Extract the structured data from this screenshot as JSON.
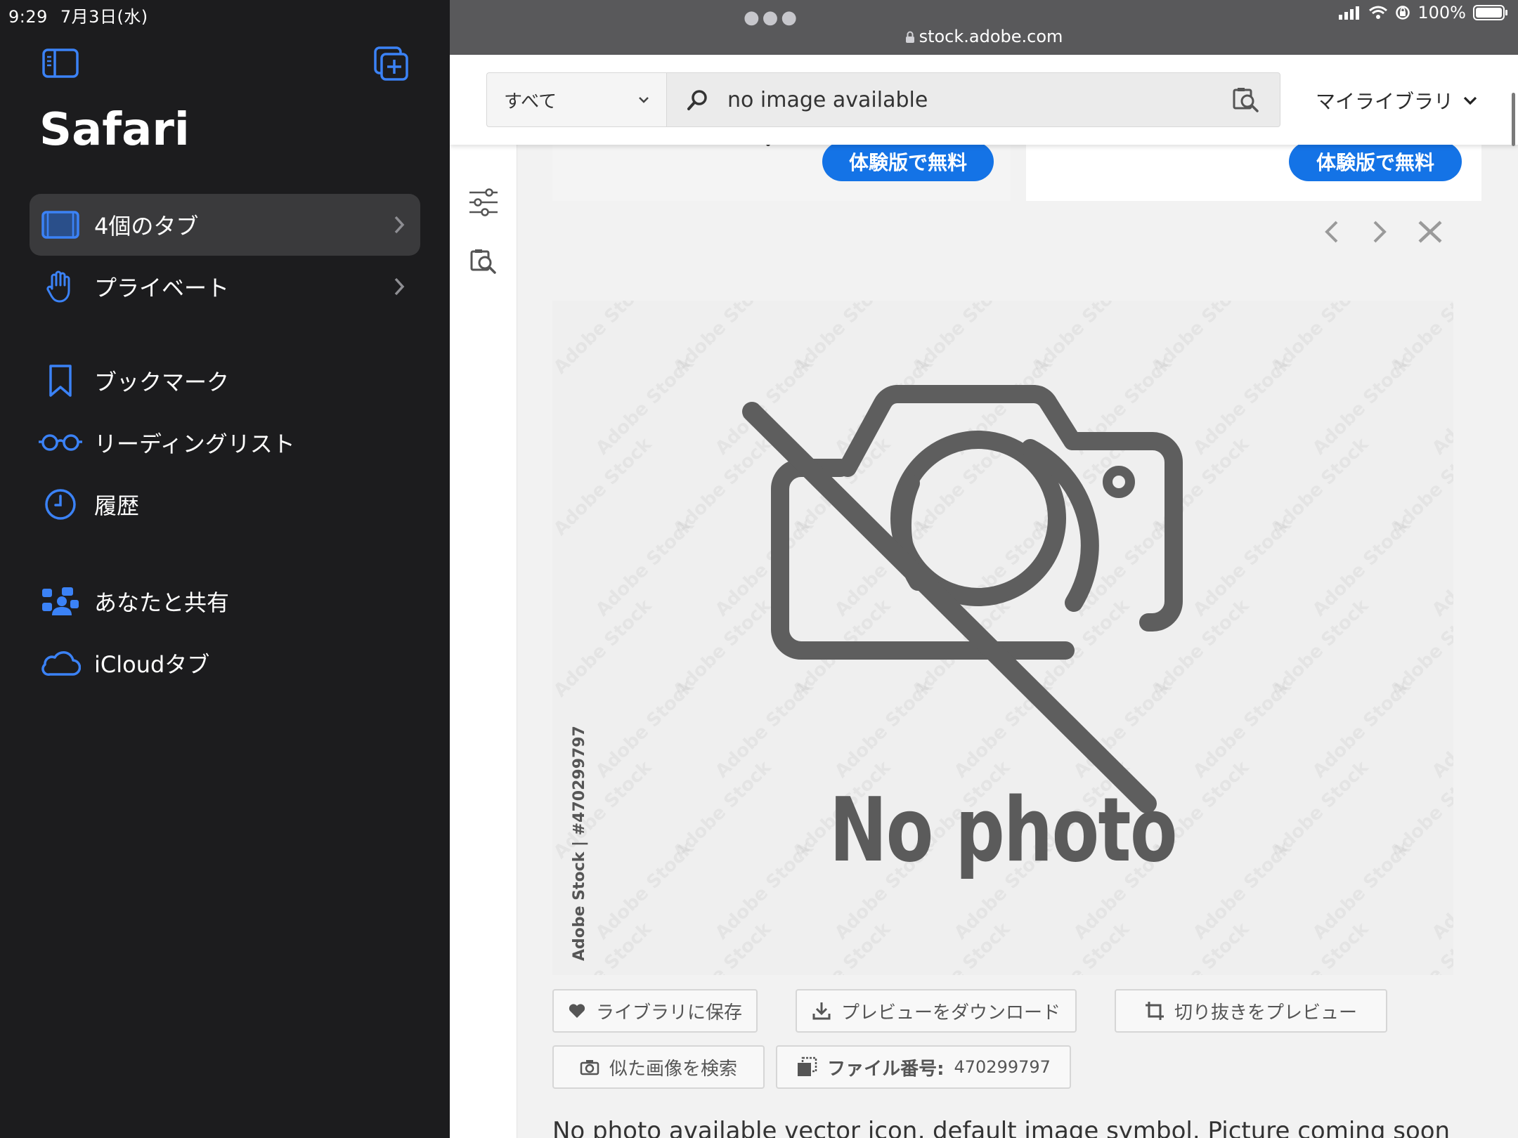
{
  "status": {
    "time": "9:29",
    "date": "7月3日(水)",
    "battery": "100%"
  },
  "sidebar": {
    "title": "Safari",
    "items": [
      {
        "label": "4個のタブ"
      },
      {
        "label": "プライベート"
      },
      {
        "label": "ブックマーク"
      },
      {
        "label": "リーディングリスト"
      },
      {
        "label": "履歴"
      },
      {
        "label": "あなたと共有"
      },
      {
        "label": "iCloudタブ"
      }
    ]
  },
  "browser": {
    "url": "stock.adobe.com",
    "search": {
      "scope": "すべて",
      "query": "no image available"
    },
    "my_library": "マイライブラリ",
    "trial_buttons": [
      "体験版で無料",
      "体験版で無料"
    ]
  },
  "asset": {
    "image_text": "No photo",
    "credit": "Adobe Stock | #470299797",
    "watermark": "Adobe Stock",
    "actions": {
      "save": "ライブラリに保存",
      "download": "プレビューをダウンロード",
      "crop": "切り抜きをプレビュー",
      "similar": "似た画像を検索",
      "file_label": "ファイル番号:",
      "file_number": "470299797"
    },
    "description": "No photo available vector icon, default image symbol. Picture coming soon"
  },
  "colors": {
    "accent": "#3b82f6",
    "trial_blue": "#1473e6",
    "sidebar_bg": "#1c1c1e"
  }
}
